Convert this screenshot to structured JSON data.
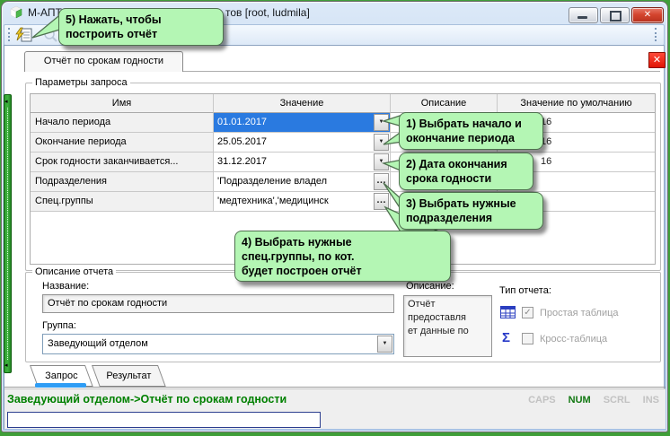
{
  "window": {
    "title_left": "М-АПТ",
    "title_right": "тов [root, ludmila]"
  },
  "tab": {
    "label": "Отчёт по срокам годности"
  },
  "params": {
    "legend": "Параметры запроса",
    "columns": [
      "Имя",
      "Значение",
      "Описание",
      "Значение по умолчанию"
    ],
    "rows": [
      {
        "name": "Начало периода",
        "value": "01.01.2017",
        "control": "dropdown",
        "default_fragment": "16",
        "selected": true
      },
      {
        "name": "Окончание периода",
        "value": "25.05.2017",
        "control": "dropdown",
        "default_fragment": "16",
        "selected": false
      },
      {
        "name": "Срок годности заканчивается...",
        "value": "31.12.2017",
        "control": "dropdown",
        "default_fragment": "16",
        "selected": false
      },
      {
        "name": "Подразделения",
        "value": "'Подразделение владел",
        "control": "ellipsis",
        "default_fragment": "",
        "selected": false
      },
      {
        "name": "Спец.группы",
        "value": "'медтехника','медицинск",
        "control": "ellipsis",
        "default_fragment": "",
        "selected": false
      }
    ]
  },
  "callouts": [
    {
      "lines": [
        "1) Выбрать начало и",
        "окончание периода"
      ]
    },
    {
      "lines": [
        "2) Дата окончания",
        "срока годности"
      ]
    },
    {
      "lines": [
        "3) Выбрать нужные",
        "подразделения"
      ]
    },
    {
      "lines": [
        "4) Выбрать нужные",
        "спец.группы, по кот.",
        "будет построен отчёт"
      ]
    },
    {
      "lines": [
        "5) Нажать, чтобы",
        "построить отчёт"
      ]
    }
  ],
  "report": {
    "legend": "Описание отчета",
    "name_label": "Название:",
    "name_value": "Отчёт по срокам годности",
    "group_label": "Группа:",
    "group_value": "Заведующий отделом",
    "desc_label": "Описание:",
    "desc_lines": [
      "Отчёт",
      "предоставля",
      "ет данные по"
    ],
    "type_label": "Тип отчета:",
    "type_options": [
      {
        "label": "Простая таблица",
        "checked": true
      },
      {
        "label": "Кросс-таблица",
        "checked": false
      }
    ]
  },
  "bottom_tabs": [
    {
      "label": "Запрос",
      "active": true
    },
    {
      "label": "Результат",
      "active": false
    }
  ],
  "status": {
    "path": "Заведующий отделом->Отчёт по срокам годности",
    "indicators": [
      {
        "label": "CAPS",
        "active": false
      },
      {
        "label": "NUM",
        "active": true
      },
      {
        "label": "SCRL",
        "active": false
      },
      {
        "label": "INS",
        "active": false
      }
    ]
  },
  "icons": {
    "close": "✕",
    "dropdown": "▼",
    "ellipsis": "…",
    "check": "✓",
    "sigma": "Σ",
    "collapse": "◂"
  },
  "colors": {
    "selection": "#2a7ae0",
    "callout_fill": "#b4f6b4",
    "status_green": "#008000",
    "desktop_green": "#3f9e38",
    "close_red": "#e01405"
  }
}
